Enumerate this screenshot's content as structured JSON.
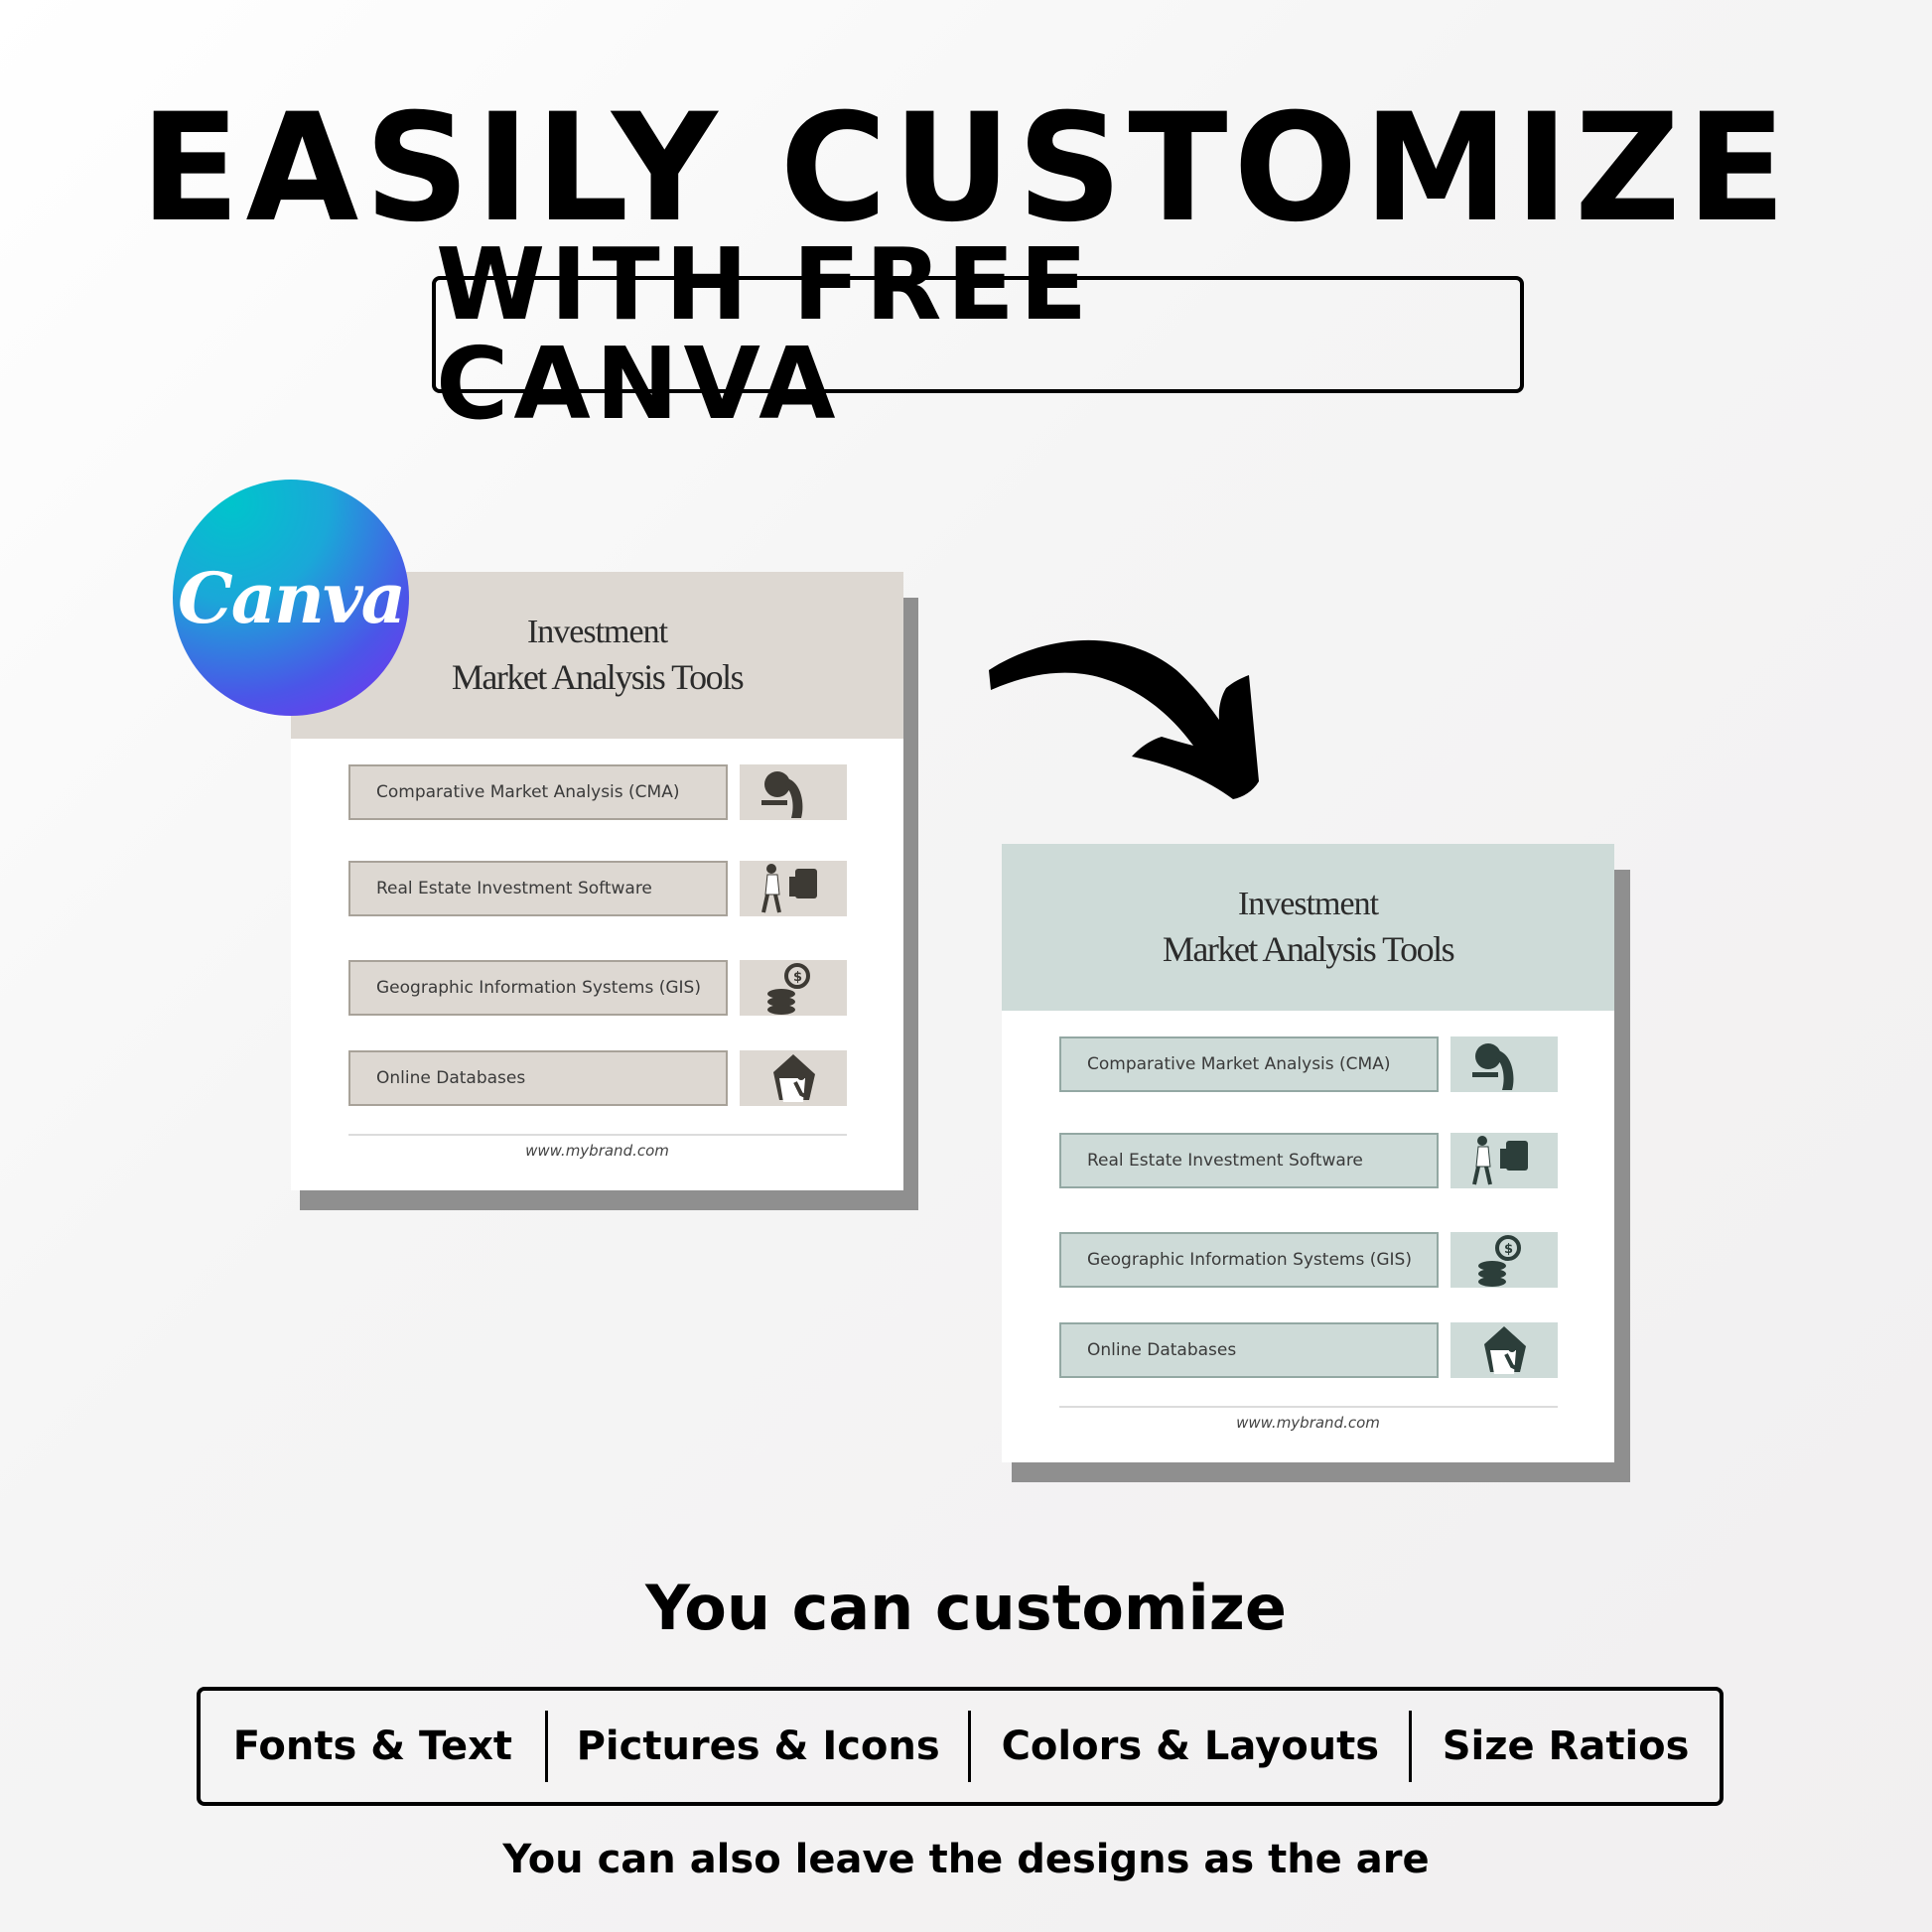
{
  "headline": "EASILY CUSTOMIZE",
  "subheadline": "WITH FREE CANVA",
  "canva_logo": {
    "text": "Canva",
    "icon": "canva-logo-icon"
  },
  "arrow_icon": "curved-arrow-icon",
  "templates": [
    {
      "variant": "original",
      "header_color": "#ddd8d2",
      "row_fill": "#ddd8d2",
      "row_border": "#a8a299",
      "illustration_color": "#3d3a34",
      "title_line1": "Investment",
      "title_line2": "Market Analysis Tools",
      "items": [
        {
          "label": "Comparative Market Analysis (CMA)",
          "illustration": "lightbulb-person-icon"
        },
        {
          "label": "Real Estate Investment Software",
          "illustration": "person-carrying-device-icon"
        },
        {
          "label": "Geographic Information Systems (GIS)",
          "illustration": "coins-stack-person-icon"
        },
        {
          "label": "Online Databases",
          "illustration": "house-person-icon"
        }
      ],
      "footer_url": "www.mybrand.com"
    },
    {
      "variant": "customized",
      "header_color": "#cedbd8",
      "row_fill": "#cedbd8",
      "row_border": "#93a8a3",
      "illustration_color": "#2c3e3a",
      "title_line1": "Investment",
      "title_line2": "Market Analysis Tools",
      "items": [
        {
          "label": "Comparative Market Analysis (CMA)",
          "illustration": "lightbulb-person-icon"
        },
        {
          "label": "Real Estate Investment Software",
          "illustration": "person-carrying-device-icon"
        },
        {
          "label": "Geographic Information Systems (GIS)",
          "illustration": "coins-stack-person-icon"
        },
        {
          "label": "Online Databases",
          "illustration": "house-person-icon"
        }
      ],
      "footer_url": "www.mybrand.com"
    }
  ],
  "customize_heading": "You can customize",
  "features": [
    "Fonts & Text",
    "Pictures & Icons",
    "Colors & Layouts",
    "Size Ratios"
  ],
  "footer_note": "You can also leave the designs as the are"
}
